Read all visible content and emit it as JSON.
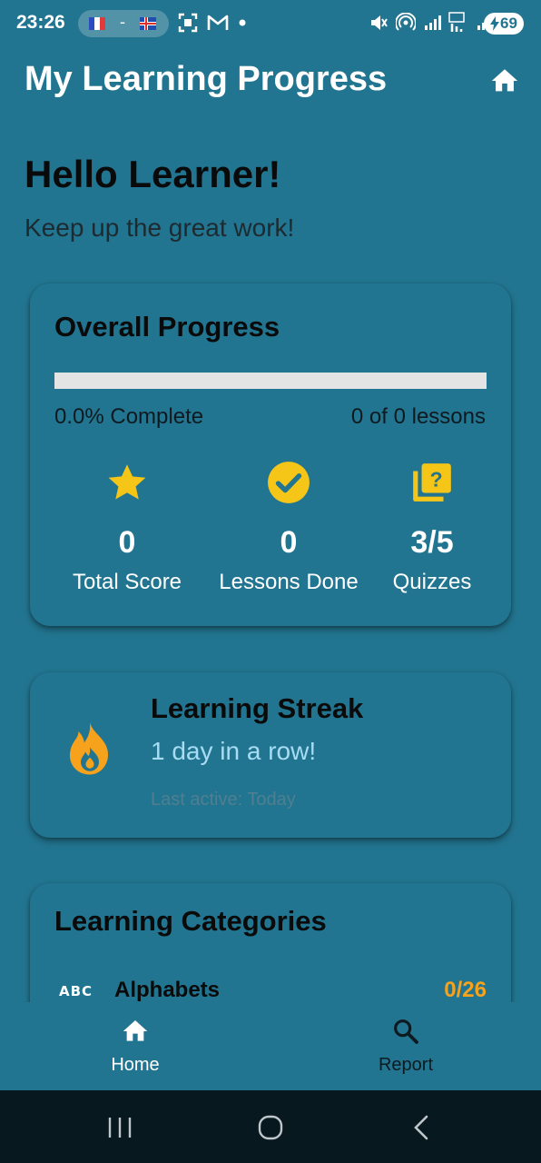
{
  "status_bar": {
    "time": "23:26",
    "separator": "-",
    "battery": "69",
    "icons": [
      "flag-france-icon",
      "flag-iceland-icon",
      "screenshot-icon",
      "gmail-icon",
      "dot-icon",
      "mute-vibrate-icon",
      "hotspot-icon",
      "signal-icon",
      "5g-signal-icon",
      "signal-icon",
      "battery-charging-icon"
    ]
  },
  "app_bar": {
    "title": "My Learning Progress",
    "action_icon": "home-icon"
  },
  "greeting": {
    "title": "Hello Learner!",
    "subtitle": "Keep up the great work!"
  },
  "overall_progress": {
    "title": "Overall Progress",
    "progress_fraction": 0.0,
    "percent_text": "0.0% Complete",
    "lessons_text": "0 of 0 lessons",
    "stats": [
      {
        "icon": "star-icon",
        "value": "0",
        "label": "Total Score"
      },
      {
        "icon": "check-circle-icon",
        "value": "0",
        "label": "Lessons Done"
      },
      {
        "icon": "quiz-icon",
        "value": "3/5",
        "label": "Quizzes"
      }
    ]
  },
  "streak": {
    "icon": "flame-icon",
    "title": "Learning Streak",
    "days_text": "1 day in a row!",
    "last_active": "Last active: Today"
  },
  "categories": {
    "title": "Learning Categories",
    "items": [
      {
        "icon_text": "ABC",
        "name": "Alphabets",
        "count": "0/26"
      }
    ]
  },
  "bottom_nav": {
    "items": [
      {
        "icon": "home-icon",
        "label": "Home",
        "active": true
      },
      {
        "icon": "search-icon",
        "label": "Report",
        "active": false
      }
    ]
  },
  "system_nav": [
    "recents-icon",
    "home-circle-icon",
    "back-icon"
  ],
  "colors": {
    "background": "#227590",
    "accent_yellow": "#f5c518",
    "accent_orange": "#f6a21c",
    "streak_text": "#a7dcf2"
  }
}
